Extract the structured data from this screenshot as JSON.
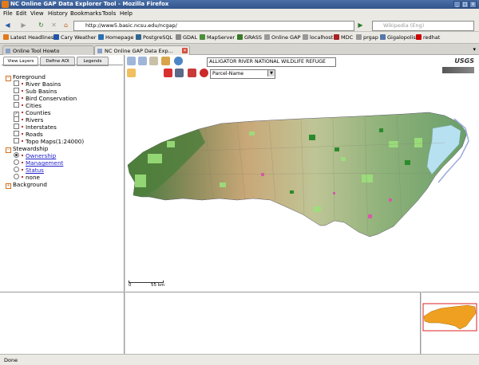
{
  "window": {
    "title": "NC Online GAP Data Explorer Tool - Mozilla Firefox"
  },
  "menu": [
    "File",
    "Edit",
    "View",
    "History",
    "Bookmarks",
    "Tools",
    "Help"
  ],
  "nav": {
    "url": "http://www5.basic.ncsu.edu/ncgap/",
    "search_placeholder": "Wikipedia (Eng)"
  },
  "bookmarks": [
    {
      "label": "Latest Headlines",
      "color": "#e07a1b"
    },
    {
      "label": "Cary Weather",
      "color": "#2255aa"
    },
    {
      "label": "Homepage",
      "color": "#2a6fb0"
    },
    {
      "label": "PostgreSQL",
      "color": "#336791"
    },
    {
      "label": "GDAL",
      "color": "#888888"
    },
    {
      "label": "MapServer",
      "color": "#4a8f3a"
    },
    {
      "label": "GRASS",
      "color": "#3a7a2a"
    },
    {
      "label": "Online GAP",
      "color": "#999999"
    },
    {
      "label": "localhost",
      "color": "#999999"
    },
    {
      "label": "MDC",
      "color": "#aa2222"
    },
    {
      "label": "prgap",
      "color": "#999999"
    },
    {
      "label": "Gigalopolis",
      "color": "#5577aa"
    },
    {
      "label": "redhat",
      "color": "#cc0000"
    }
  ],
  "tabs": [
    {
      "label": "Online Tool Howto",
      "active": false
    },
    {
      "label": "NC Online GAP Data Exp...",
      "active": true
    }
  ],
  "sidebar": {
    "tabs": [
      "View Layers",
      "Define AOI",
      "Legends"
    ],
    "foreground": {
      "label": "Foreground",
      "layers": [
        {
          "label": "River Basins",
          "checked": false
        },
        {
          "label": "Sub Basins",
          "checked": false
        },
        {
          "label": "Bird Conservation",
          "checked": false
        },
        {
          "label": "Cities",
          "checked": false
        },
        {
          "label": "Counties",
          "checked": true
        },
        {
          "label": "Rivers",
          "checked": false
        },
        {
          "label": "Interstates",
          "checked": false
        },
        {
          "label": "Roads",
          "checked": false
        },
        {
          "label": "Topo Maps(1:24000)",
          "checked": false
        }
      ]
    },
    "stewardship": {
      "label": "Stewardship",
      "options": [
        {
          "label": "Ownership",
          "selected": true,
          "link": true
        },
        {
          "label": "Management",
          "selected": false,
          "link": true
        },
        {
          "label": "Status",
          "selected": false,
          "link": true
        },
        {
          "label": "none",
          "selected": false,
          "link": false
        }
      ]
    },
    "background": {
      "label": "Background"
    }
  },
  "map": {
    "location_value": "ALLIGATOR RIVER NATIONAL WILDLIFE REFUGE",
    "parcel_select": "Parcel-Name",
    "logo_text": "USGS",
    "scale_labels": [
      "0",
      "55 km"
    ]
  },
  "status": "Done"
}
